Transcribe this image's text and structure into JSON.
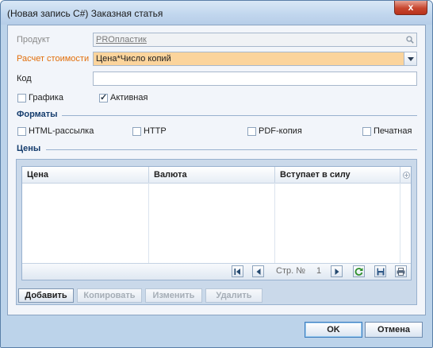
{
  "window": {
    "title": "(Новая запись C#) Заказная статья",
    "close_label": "x"
  },
  "form": {
    "product": {
      "label": "Продукт",
      "value": "PROпластик"
    },
    "calc": {
      "label": "Расчет стоимости",
      "value": "Цена*Число копий"
    },
    "code": {
      "label": "Код",
      "value": ""
    },
    "graphics": {
      "label": "Графика",
      "checked": false
    },
    "active": {
      "label": "Активная",
      "checked": true
    }
  },
  "formats": {
    "title": "Форматы",
    "items": [
      {
        "label": "HTML-рассылка",
        "checked": false
      },
      {
        "label": "HTTP",
        "checked": false
      },
      {
        "label": "PDF-копия",
        "checked": false
      },
      {
        "label": "Печатная",
        "checked": false
      }
    ]
  },
  "prices": {
    "title": "Цены",
    "columns": [
      "Цена",
      "Валюта",
      "Вступает в силу"
    ],
    "pager": {
      "page_label": "Стр. №",
      "page_number": "1"
    },
    "buttons": [
      "Добавить",
      "Копировать",
      "Изменить",
      "Удалить"
    ]
  },
  "dialog": {
    "ok": "OK",
    "cancel": "Отмена"
  }
}
